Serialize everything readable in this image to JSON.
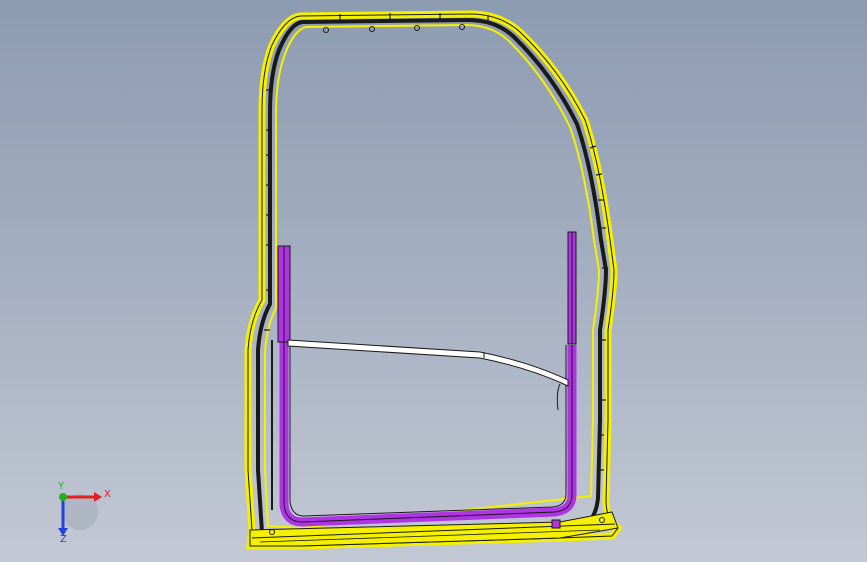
{
  "viewport": {
    "background_top": "#8d9bb1",
    "background_bottom": "#c3c9d4"
  },
  "model": {
    "frame_outline_color": "#f4f000",
    "frame_edge_color": "#1a1a1a",
    "inner_frame_color": "#b033e6",
    "cross_bar_color": "#ffffff"
  },
  "triad": {
    "x_label": "X",
    "y_label": "Y",
    "z_label": "Z",
    "x_color": "#e22222",
    "y_color": "#22b022",
    "z_color": "#2244dd"
  }
}
